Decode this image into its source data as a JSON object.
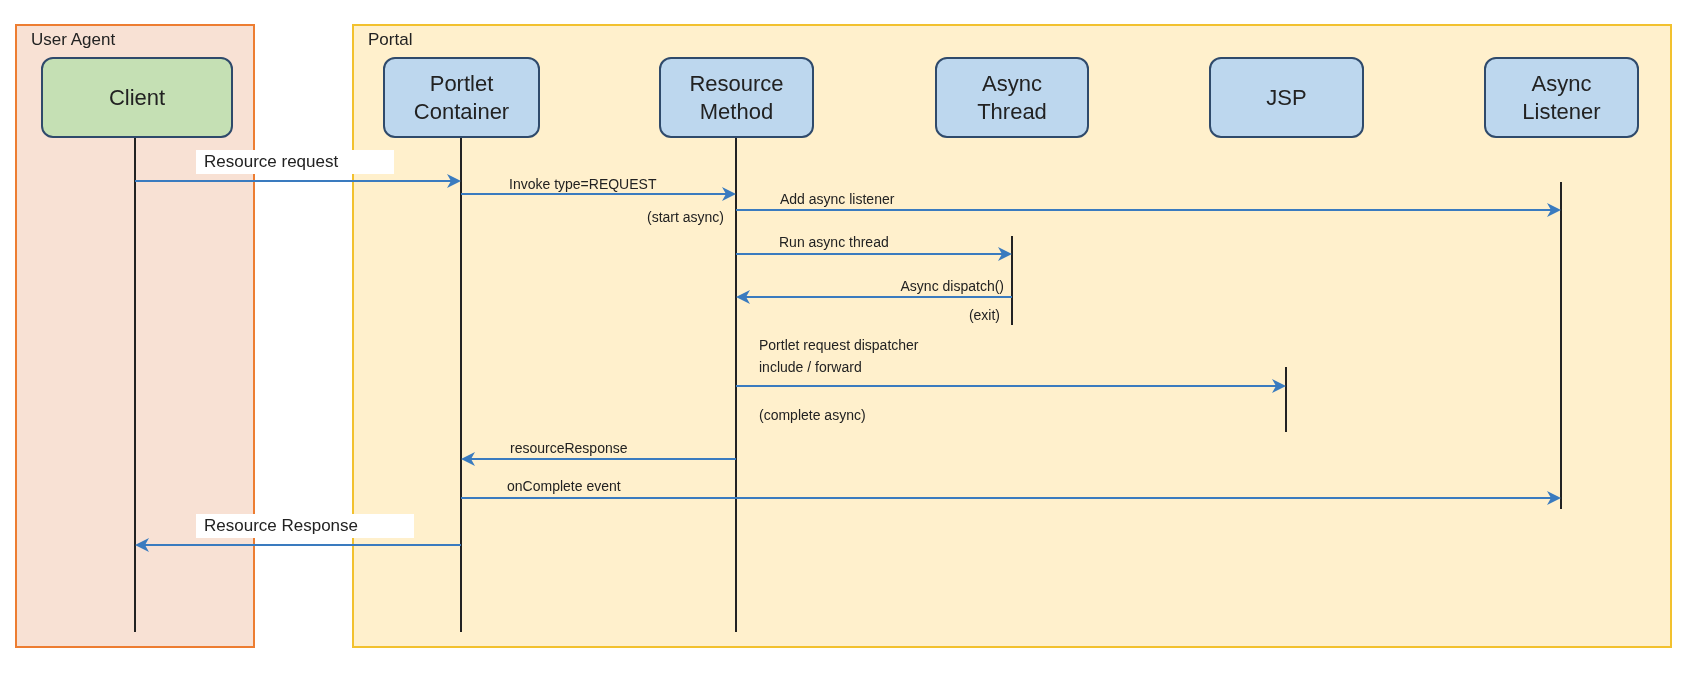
{
  "frames": [
    {
      "label": "User Agent",
      "color": "#f8e1d4"
    },
    {
      "label": "Portal",
      "color": "#fff0cc"
    }
  ],
  "participants": [
    {
      "label": "Client",
      "color": "#c5e0b4"
    },
    {
      "label": "Portlet Container",
      "color": "#bdd7ee"
    },
    {
      "label": "Resource Method",
      "color": "#bdd7ee"
    },
    {
      "label": "Async Thread",
      "color": "#bdd7ee"
    },
    {
      "label": "JSP",
      "color": "#bdd7ee"
    },
    {
      "label": "Async Listener",
      "color": "#bdd7ee"
    }
  ],
  "messages": [
    {
      "label_lines": [
        "Resource request"
      ],
      "kind": "external"
    },
    {
      "label_lines": [
        "Invoke type=REQUEST"
      ],
      "kind": "internal"
    },
    {
      "label_lines": [
        "Add async listener"
      ],
      "kind": "internal"
    },
    {
      "label_lines": [
        "Run async thread"
      ],
      "kind": "internal"
    },
    {
      "label_lines": [
        "Async dispatch()"
      ],
      "kind": "internal"
    },
    {
      "label_lines": [
        "Portlet request dispatcher",
        "include / forward"
      ],
      "kind": "internal"
    },
    {
      "label_lines": [
        "resourceResponse"
      ],
      "kind": "internal"
    },
    {
      "label_lines": [
        "onComplete event"
      ],
      "kind": "internal"
    },
    {
      "label_lines": [
        "Resource Response"
      ],
      "kind": "external"
    }
  ],
  "notes": [
    "(start async)",
    "(exit)",
    "(complete async)"
  ]
}
